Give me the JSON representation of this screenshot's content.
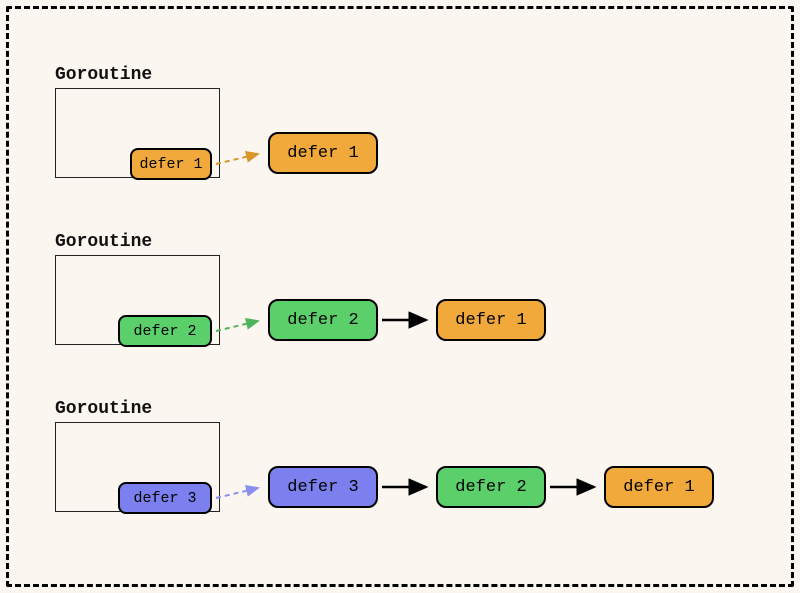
{
  "labels": {
    "goroutine": "Goroutine"
  },
  "row1": {
    "inner": "defer 1",
    "chain": [
      "defer 1"
    ]
  },
  "row2": {
    "inner": "defer 2",
    "chain": [
      "defer 2",
      "defer 1"
    ]
  },
  "row3": {
    "inner": "defer 3",
    "chain": [
      "defer 3",
      "defer 2",
      "defer 1"
    ]
  },
  "colors": {
    "orange": "#f0a93a",
    "green": "#5bcf6a",
    "purple": "#7b80ee"
  }
}
